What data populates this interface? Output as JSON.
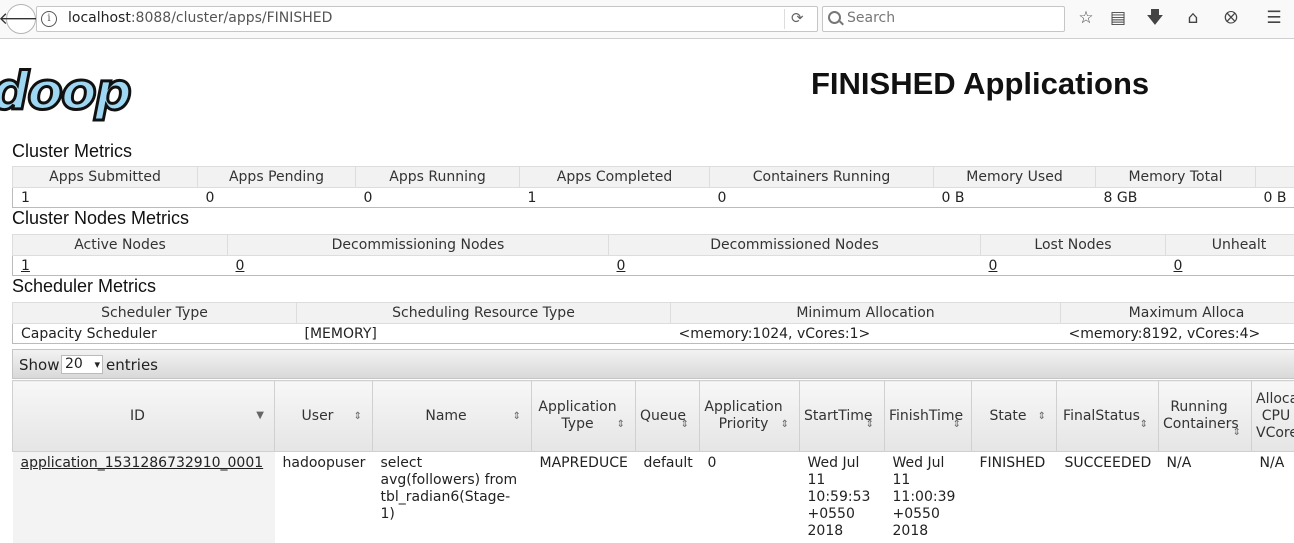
{
  "browser": {
    "url_host": "localhost",
    "url_rest": ":8088/cluster/apps/FINISHED",
    "search_placeholder": "Search"
  },
  "page": {
    "logo_text": "doop",
    "title": "FINISHED Applications"
  },
  "cluster_metrics": {
    "title": "Cluster Metrics",
    "headers": [
      "Apps Submitted",
      "Apps Pending",
      "Apps Running",
      "Apps Completed",
      "Containers Running",
      "Memory Used",
      "Memory Total",
      ""
    ],
    "values": [
      "1",
      "0",
      "0",
      "1",
      "0",
      "0 B",
      "8 GB",
      "0 B"
    ]
  },
  "cluster_nodes_metrics": {
    "title": "Cluster Nodes Metrics",
    "headers": [
      "Active Nodes",
      "Decommissioning Nodes",
      "Decommissioned Nodes",
      "Lost Nodes",
      "Unhealt"
    ],
    "values": [
      "1",
      "0",
      "0",
      "0",
      "0"
    ]
  },
  "scheduler_metrics": {
    "title": "Scheduler Metrics",
    "headers": [
      "Scheduler Type",
      "Scheduling Resource Type",
      "Minimum Allocation",
      "Maximum Alloca"
    ],
    "values": [
      "Capacity Scheduler",
      "[MEMORY]",
      "<memory:1024, vCores:1>",
      "<memory:8192, vCores:4>"
    ]
  },
  "table_controls": {
    "show_label": "Show",
    "page_length": "20",
    "entries_label": "entries"
  },
  "apps_table": {
    "headers": [
      "ID",
      "User",
      "Name",
      "Application Type",
      "Queue",
      "Application Priority",
      "StartTime",
      "FinishTime",
      "State",
      "FinalStatus",
      "Running Containers",
      "Alloca CPU VCore"
    ],
    "rows": [
      {
        "id": "application_1531286732910_0001",
        "user": "hadoopuser",
        "name": "select avg(followers) from tbl_radian6(Stage-1)",
        "type": "MAPREDUCE",
        "queue": "default",
        "priority": "0",
        "start": "Wed Jul 11 10:59:53 +0550 2018",
        "finish": "Wed Jul 11 11:00:39 +0550 2018",
        "state": "FINISHED",
        "final_status": "SUCCEEDED",
        "running_containers": "N/A",
        "allocated_cpu": "N/A"
      }
    ]
  }
}
